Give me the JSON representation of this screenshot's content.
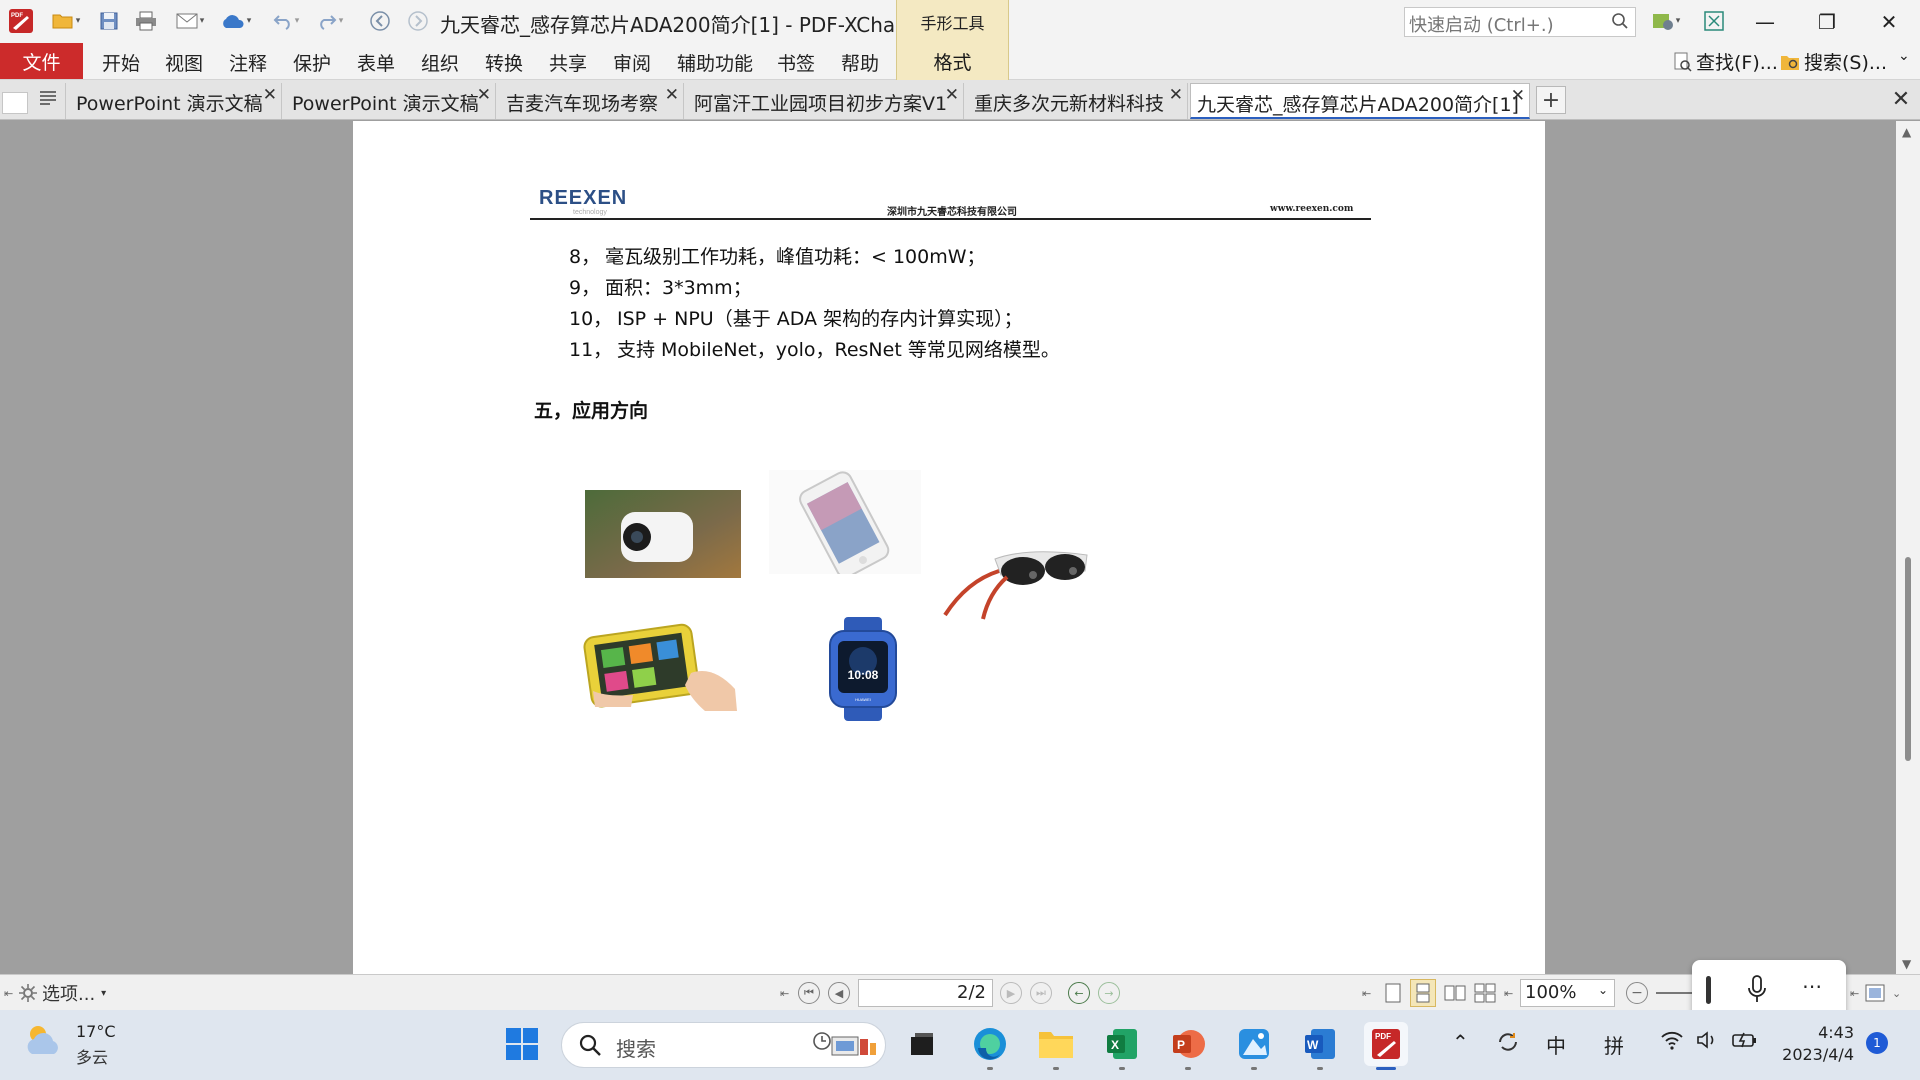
{
  "window": {
    "title": "九天睿芯_感存算芯片ADA200简介[1] - PDF-XChange ...",
    "context_tab_group": "手形工具",
    "quick_launch_placeholder": "快速启动 (Ctrl+.)",
    "minimize": "—",
    "restore": "❐",
    "close": "✕"
  },
  "menu": {
    "file": "文件",
    "items": [
      "开始",
      "视图",
      "注释",
      "保护",
      "表单",
      "组织",
      "转换",
      "共享",
      "审阅",
      "辅助功能",
      "书签",
      "帮助"
    ],
    "context_tab": "格式",
    "find": "查找(F)...",
    "search": "搜索(S)..."
  },
  "doc_tabs": [
    {
      "label": "PowerPoint 演示文稿",
      "active": false
    },
    {
      "label": "PowerPoint 演示文稿",
      "active": false
    },
    {
      "label": "吉麦汽车现场考察",
      "active": false
    },
    {
      "label": "阿富汗工业园项目初步方案V1",
      "active": false
    },
    {
      "label": "重庆多次元新材料科技",
      "active": false
    },
    {
      "label": "九天睿芯_感存算芯片ADA200简介[1]",
      "active": true
    }
  ],
  "document": {
    "header_logo": "REEXEN",
    "header_logo_sub": "technology",
    "header_company": "深圳市九天睿芯科技有限公司",
    "header_url": "www.reexen.com",
    "spec_items": [
      {
        "num": "8，",
        "text": "毫瓦级别工作功耗，峰值功耗：< 100mW；"
      },
      {
        "num": "9，",
        "text": "面积：3*3mm；"
      },
      {
        "num": "10，",
        "text": "ISP + NPU（基于 ADA 架构的存内计算实现）；"
      },
      {
        "num": "11，",
        "text": "支持 MobileNet，yolo，ResNet 等常见网络模型。"
      }
    ],
    "section_title": "五，应用方向",
    "watch_time": "10:08",
    "watch_brand": "HUAWEI"
  },
  "statusbar": {
    "options": "选项...",
    "page_display": "2/2",
    "zoom": "100%"
  },
  "taskbar": {
    "weather_temp": "17°C",
    "weather_cond": "多云",
    "search_label": "搜索",
    "ime_lang": "中",
    "ime_mode": "拼",
    "time": "4:43",
    "date": "2023/4/4",
    "notifications": "1"
  },
  "colors": {
    "file_tab": "#cc2b2b",
    "context_tab": "#f4e9c2",
    "workspace": "#9f9f9f",
    "taskbar": "#dfe6ef",
    "accent": "#2b5fbf"
  }
}
